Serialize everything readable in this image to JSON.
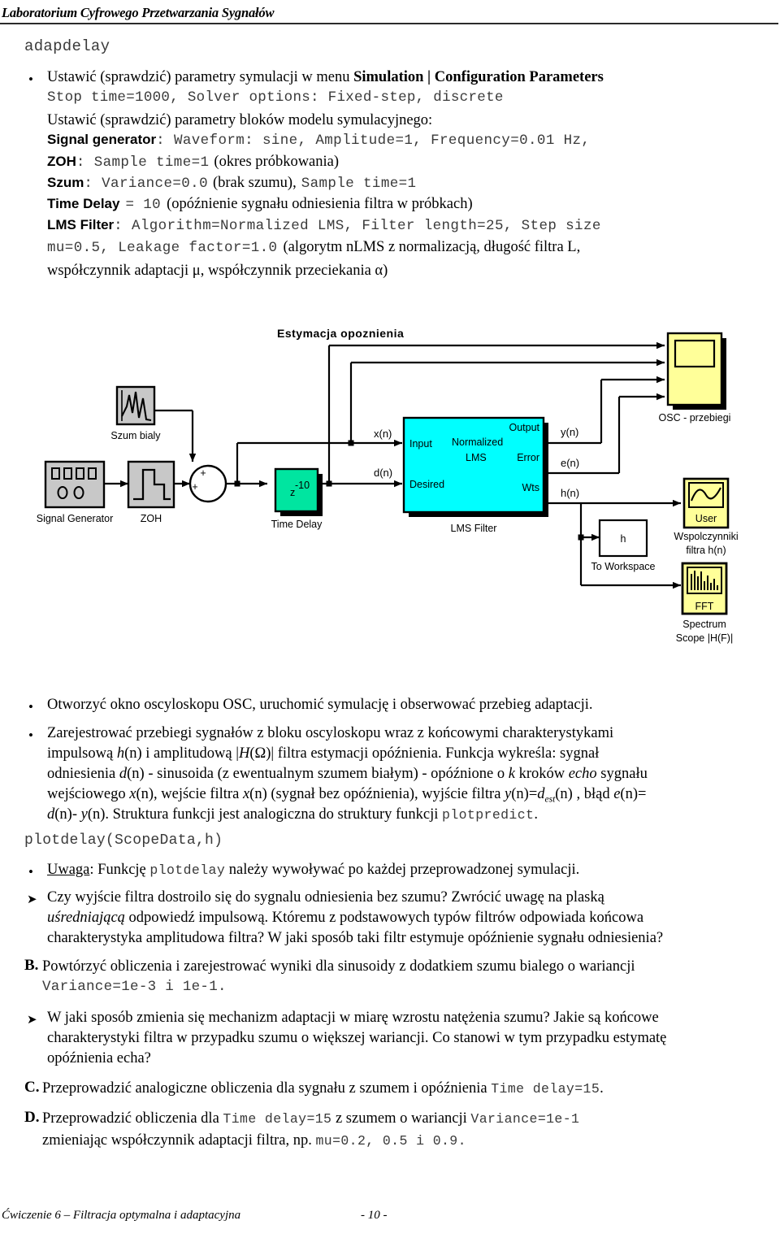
{
  "header": {
    "title": "Laboratorium Cyfrowego Przetwarzania Sygnałów"
  },
  "model_name": "adapdelay",
  "setup": {
    "b1_line1_a": "Ustawić (sprawdzić) parametry symulacji w menu ",
    "b1_line1_b": "Simulation | Configuration Parameters",
    "b1_line2": "Stop time=1000, Solver options: Fixed-step, discrete",
    "b1_line3": "Ustawić (sprawdzić) parametry bloków modelu symulacyjnego:",
    "siggen_label": "Signal generator",
    "siggen_value": ": Waveform: sine, Amplitude=1, Frequency=0.01 Hz,",
    "zoh_label": "ZOH",
    "zoh_value": ": Sample time=1",
    "zoh_note": "(okres próbkowania)",
    "szum_label": "Szum",
    "szum_value": ": Variance=0.0",
    "szum_note": "(brak szumu),",
    "szum_value2": "Sample time=1",
    "delay_label": "Time Delay",
    "delay_value": "= 10",
    "delay_note": "(opóźnienie sygnału odniesienia filtra w próbkach)",
    "lms_label": "LMS Filter",
    "lms_value": ": Algorithm=Normalized LMS, Filter length=25, Step size",
    "lms_value2": "mu=0.5, Leakage factor=1.0",
    "lms_note1": "(algorytm nLMS z normalizacją, długość filtra L,",
    "lms_note2": "współczynnik adaptacji μ, współczynnik przeciekania α)"
  },
  "diagram": {
    "title": "Estymacja opoznienia",
    "blocks": {
      "signal_generator": "Signal Generator",
      "zoh": "ZOH",
      "szum_bialy": "Szum bialy",
      "sum_plus_top": "+",
      "sum_plus_left": "+",
      "time_delay": "Time Delay",
      "time_delay_z": "z",
      "time_delay_exp": "-10",
      "lms_filter": "LMS Filter",
      "lms_in_input": "Input",
      "lms_in_desired": "Desired",
      "lms_core_1": "Normalized",
      "lms_core_2": "LMS",
      "lms_out_output": "Output",
      "lms_out_error": "Error",
      "lms_out_wts": "Wts",
      "osc": "OSC - przebiegi",
      "user_scope_caption_1": "Wspolczynniki",
      "user_scope_caption_2": "filtra h(n)",
      "user_scope_label": "User",
      "to_workspace_var": "h",
      "to_workspace": "To Workspace",
      "fft_label": "FFT",
      "spectrum_1": "Spectrum",
      "spectrum_2": "Scope |H(F)|"
    },
    "signals": {
      "xn": "x(n)",
      "dn": "d(n)",
      "yn": "y(n)",
      "en": "e(n)",
      "hn": "h(n)"
    },
    "colors": {
      "block_gray": "#c8c8c8",
      "delay_green": "#00e5a0",
      "lms_cyan": "#00ffff",
      "scope_yellow": "#ffff99",
      "shadow": "#000000",
      "wire": "#000000"
    }
  },
  "body": {
    "b2": "Otworzyć okno oscyloskopu OSC, uruchomić symulację i obserwować przebieg adaptacji.",
    "b3_l1": "Zarejestrować przebiegi sygnałów z bloku oscyloskopu wraz z końcowymi charakterystykami",
    "b3_l2_a": "impulsową ",
    "b3_l2_h": "h",
    "b3_l2_b": "(n) i amplitudową |",
    "b3_l2_H": "H",
    "b3_l2_c": "(Ω)| filtra estymacji opóźnienia.  Funkcja wykreśla: sygnał",
    "b3_l3_a": "odniesienia ",
    "b3_l3_d": "d",
    "b3_l3_b": "(n) - sinusoida (z ewentualnym szumem białym) - opóźnione o ",
    "b3_l3_k": "k",
    "b3_l3_c": " kroków ",
    "b3_l3_echo": "echo",
    "b3_l3_d2": " sygnału",
    "b3_l4_a": "wejściowego ",
    "b3_l4_x": "x",
    "b3_l4_b": "(n), wejście filtra ",
    "b3_l4_x2": "x",
    "b3_l4_c": "(n) (sygnał bez opóźnienia), wyjście filtra ",
    "b3_l4_y": "y",
    "b3_l4_d": "(n)=",
    "b3_l4_dest": "d",
    "b3_l4_sub": "est",
    "b3_l4_e": "(n) , błąd ",
    "b3_l4_err": "e",
    "b3_l4_f": "(n)=",
    "b3_l5_a": "d",
    "b3_l5_b": "(n)- ",
    "b3_l5_y": "y",
    "b3_l5_c": "(n).  Struktura funkcji jest analogiczna do struktury funkcji ",
    "b3_l5_code": "plotpredict",
    "b3_l5_d": ".",
    "call_line": "plotdelay(ScopeData,h)",
    "b4_uwaga": "Uwaga",
    "b4_a": ": Funkcję ",
    "b4_code": "plotdelay",
    "b4_b": " należy wywoływać po każdej przeprowadzonej symulacji.",
    "q1_l1": "Czy wyjście filtra dostroilo się do sygnalu odniesienia bez szumu? Zwrócić uwagę na plaską",
    "q1_l2_i": "uśredniającą",
    "q1_l2_a": " odpowiedź impulsową. Któremu z podstawowych typów filtrów  odpowiada końcowa",
    "q1_l3": "charakterystyka amplitudowa filtra? W jaki sposób taki filtr estymuje opóźnienie sygnału odniesienia?",
    "secB_marker": "B.",
    "secB_l1": "Powtórzyć obliczenia i zarejestrować wyniki dla sinusoidy z dodatkiem szumu bialego o wariancji",
    "secB_l2_code": "Variance=1e-3 i 1e-1.",
    "q2_l1": "W jaki sposób zmienia się mechanizm adaptacji w miarę wzrostu natężenia szumu? Jakie są końcowe",
    "q2_l2": "charakterystyki filtra w przypadku szumu o większej wariancji. Co stanowi w tym przypadku estymatę",
    "q2_l3": "opóźnienia echa?",
    "secC_marker": "C.",
    "secC_a": "Przeprowadzić analogiczne obliczenia dla sygnału z szumem i opóźnienia ",
    "secC_code": "Time delay=15",
    "secC_b": ".",
    "secD_marker": "D.",
    "secD_l1_a": "Przeprowadzić obliczenia dla ",
    "secD_l1_code1": "Time delay=15",
    "secD_l1_b": " z  szumem o wariancji ",
    "secD_l1_code2": "Variance=1e-1",
    "secD_l2_a": "zmieniając współczynnik adaptacji filtra, np. ",
    "secD_l2_code": "mu=0.2, 0.5 i 0.9."
  },
  "footer": {
    "left": "Ćwiczenie 6 – Filtracja optymalna i adaptacyjna",
    "page": "- 10 -"
  }
}
